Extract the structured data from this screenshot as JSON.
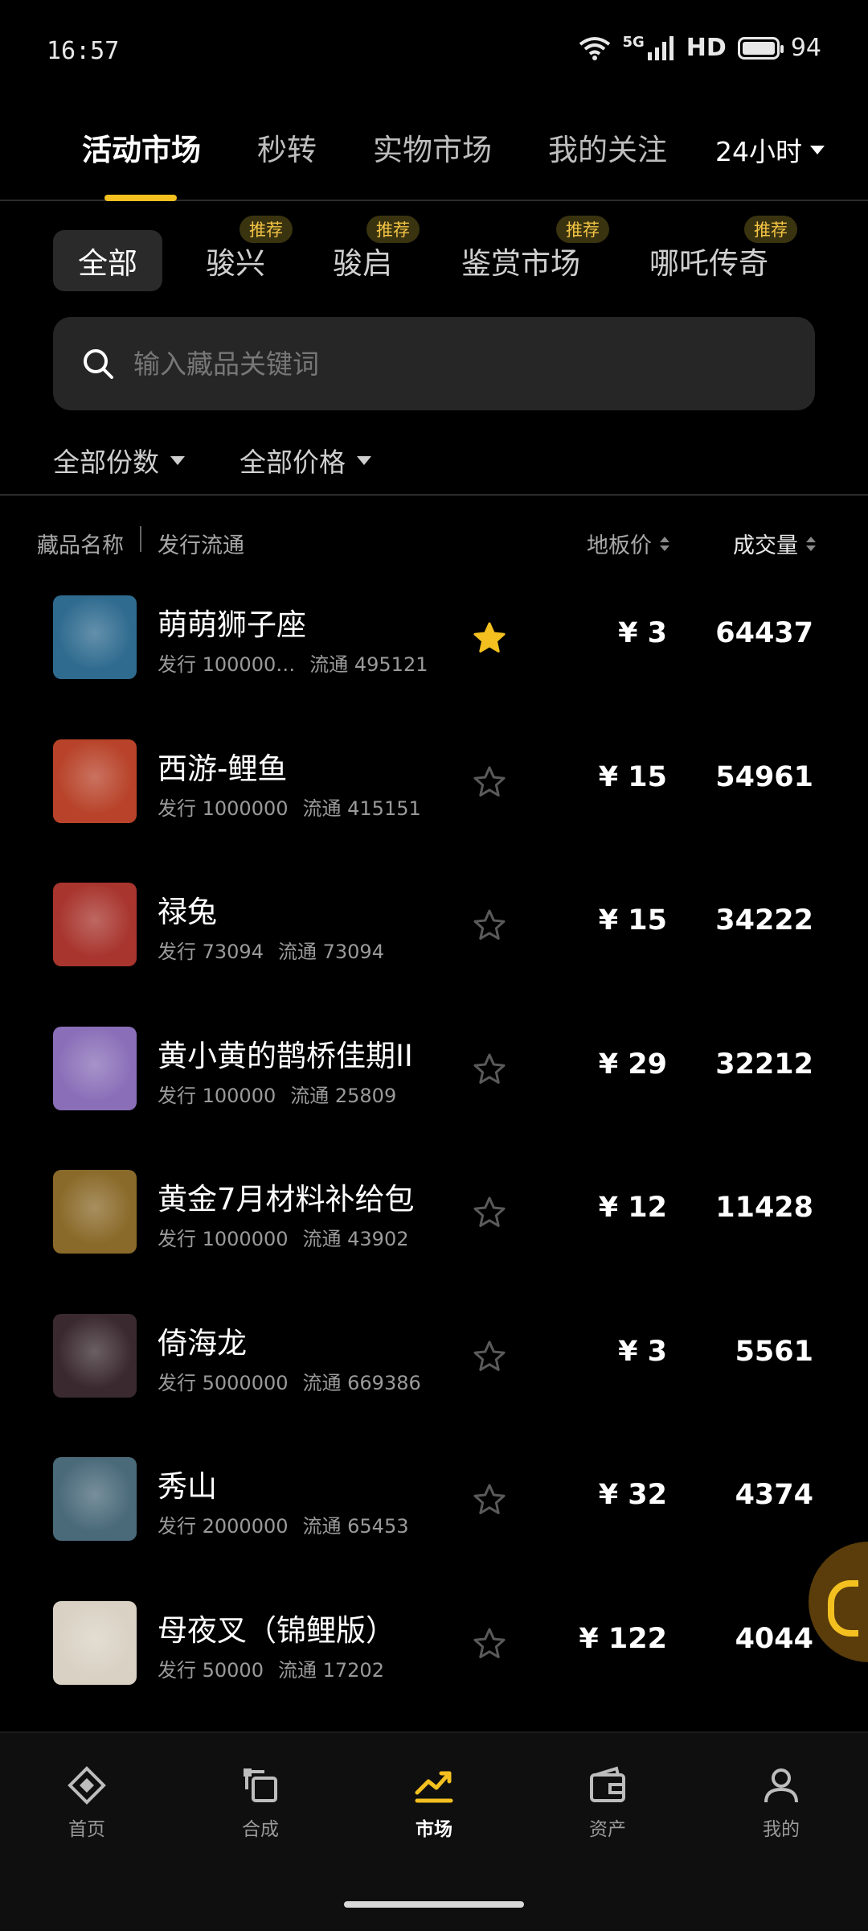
{
  "status_bar": {
    "time": "16:57",
    "network": "5G",
    "hd": "HD",
    "battery": "94"
  },
  "top_tabs": [
    {
      "label": "活动市场",
      "active": true
    },
    {
      "label": "秒转",
      "active": false
    },
    {
      "label": "实物市场",
      "active": false
    },
    {
      "label": "我的关注",
      "active": false
    }
  ],
  "time_filter": "24小时",
  "categories": [
    {
      "label": "全部",
      "active": true,
      "badge": ""
    },
    {
      "label": "骏兴",
      "active": false,
      "badge": "推荐"
    },
    {
      "label": "骏启",
      "active": false,
      "badge": "推荐"
    },
    {
      "label": "鉴赏市场",
      "active": false,
      "badge": "推荐"
    },
    {
      "label": "哪吒传奇",
      "active": false,
      "badge": "推荐"
    }
  ],
  "search": {
    "placeholder": "输入藏品关键词"
  },
  "filters": {
    "count": "全部份数",
    "price": "全部价格"
  },
  "columns": {
    "name": "藏品名称",
    "circulation": "发行流通",
    "floor_price": "地板价",
    "volume": "成交量"
  },
  "items": [
    {
      "name": "萌萌狮子座",
      "issue": "发行 100000…",
      "circ": "流通 495121",
      "price": "¥ 3",
      "volume": "64437",
      "starred": true,
      "color": "#2f6b8f"
    },
    {
      "name": "西游-鲤鱼",
      "issue": "发行 1000000",
      "circ": "流通 415151",
      "price": "¥ 15",
      "volume": "54961",
      "starred": false,
      "color": "#b8432a"
    },
    {
      "name": "禄兔",
      "issue": "发行 73094",
      "circ": "流通 73094",
      "price": "¥ 15",
      "volume": "34222",
      "starred": false,
      "color": "#a8352e"
    },
    {
      "name": "黄小黄的鹊桥佳期II",
      "issue": "发行 100000",
      "circ": "流通 25809",
      "price": "¥ 29",
      "volume": "32212",
      "starred": false,
      "color": "#8a6fb8"
    },
    {
      "name": "黄金7月材料补给包",
      "issue": "发行 1000000",
      "circ": "流通 43902",
      "price": "¥ 12",
      "volume": "11428",
      "starred": false,
      "color": "#8a6a2a"
    },
    {
      "name": "倚海龙",
      "issue": "发行 5000000",
      "circ": "流通 669386",
      "price": "¥ 3",
      "volume": "5561",
      "starred": false,
      "color": "#3a2a30"
    },
    {
      "name": "秀山",
      "issue": "发行 2000000",
      "circ": "流通 65453",
      "price": "¥ 32",
      "volume": "4374",
      "starred": false,
      "color": "#4a6a7a"
    },
    {
      "name": "母夜叉（锦鲤版）",
      "issue": "发行 50000",
      "circ": "流通 17202",
      "price": "¥ 122",
      "volume": "4044",
      "starred": false,
      "color": "#d9d2c4"
    }
  ],
  "bottom_nav": [
    {
      "label": "首页",
      "icon": "diamond-home-icon",
      "active": false
    },
    {
      "label": "合成",
      "icon": "synthesis-icon",
      "active": false
    },
    {
      "label": "市场",
      "icon": "trend-chart-icon",
      "active": true
    },
    {
      "label": "资产",
      "icon": "wallet-icon",
      "active": false
    },
    {
      "label": "我的",
      "icon": "user-icon",
      "active": false
    }
  ],
  "colors": {
    "accent": "#f3c020",
    "background": "#000000",
    "badge_bg": "#3a3310"
  }
}
